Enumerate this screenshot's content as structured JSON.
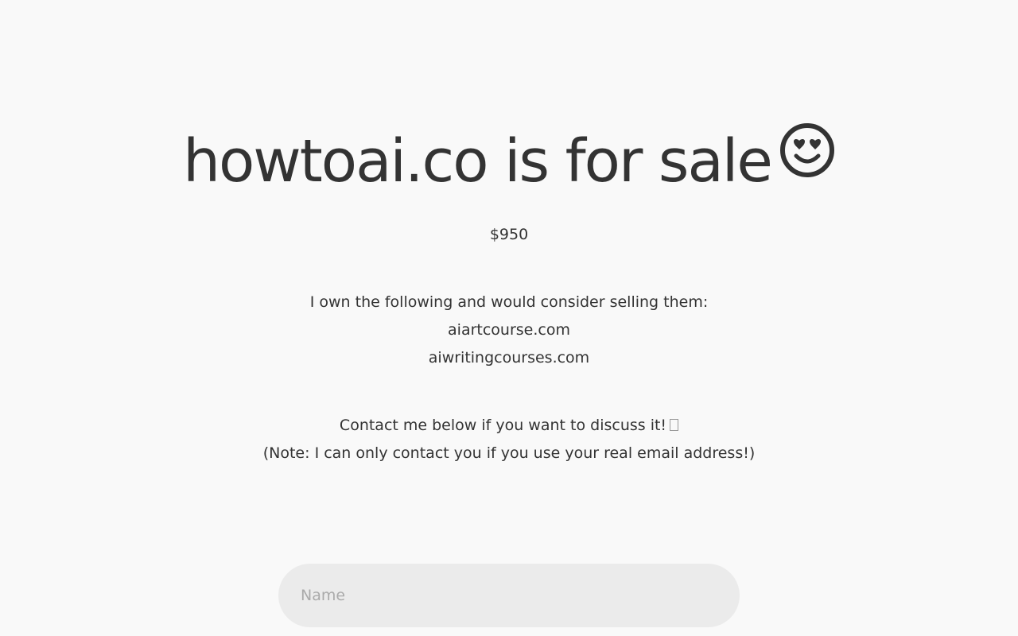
{
  "headline": {
    "text": "howtoai.co is for sale",
    "emoji_icon": "heart-eyes-smiley-icon"
  },
  "price": "$950",
  "domains": {
    "intro": "I own the following and would consider selling them:",
    "items": [
      "aiartcourse.com",
      "aiwritingcourses.com"
    ]
  },
  "contact": {
    "line1": "Contact me below if you want to discuss it!",
    "line1_trailing_glyph": "missing-glyph-box-icon",
    "line2": "(Note: I can only contact you if you use your real email address!)"
  },
  "form": {
    "name_placeholder": "Name",
    "name_value": ""
  },
  "colors": {
    "background": "#f9f9f9",
    "text": "#333333",
    "input_background": "#ebebeb",
    "placeholder": "#aaaaaa"
  }
}
